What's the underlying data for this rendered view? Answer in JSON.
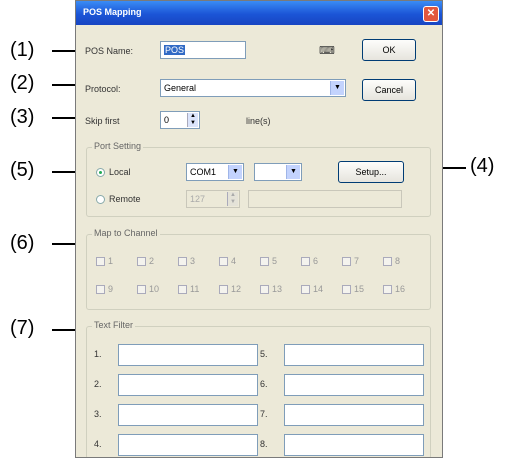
{
  "callouts": [
    "(1)",
    "(2)",
    "(3)",
    "(4)",
    "(5)",
    "(6)",
    "(7)"
  ],
  "dialog": {
    "title": "POS Mapping",
    "pos_name_label": "POS Name:",
    "pos_name_value": "POS",
    "protocol_label": "Protocol:",
    "protocol_value": "General",
    "skip_label": "Skip first",
    "skip_value": "0",
    "skip_unit": "line(s)",
    "ok_label": "OK",
    "cancel_label": "Cancel",
    "port_group_title": "Port Setting",
    "local_label": "Local",
    "remote_label": "Remote",
    "com_value": "COM1",
    "baud_value": "",
    "remote_port_value": "127",
    "setup_label": "Setup...",
    "map_group_title": "Map to Channel",
    "channels": [
      "1",
      "2",
      "3",
      "4",
      "5",
      "6",
      "7",
      "8",
      "9",
      "10",
      "11",
      "12",
      "13",
      "14",
      "15",
      "16"
    ],
    "text_filter_title": "Text Filter",
    "filters": [
      "1.",
      "2.",
      "3.",
      "4.",
      "5.",
      "6.",
      "7.",
      "8."
    ]
  }
}
